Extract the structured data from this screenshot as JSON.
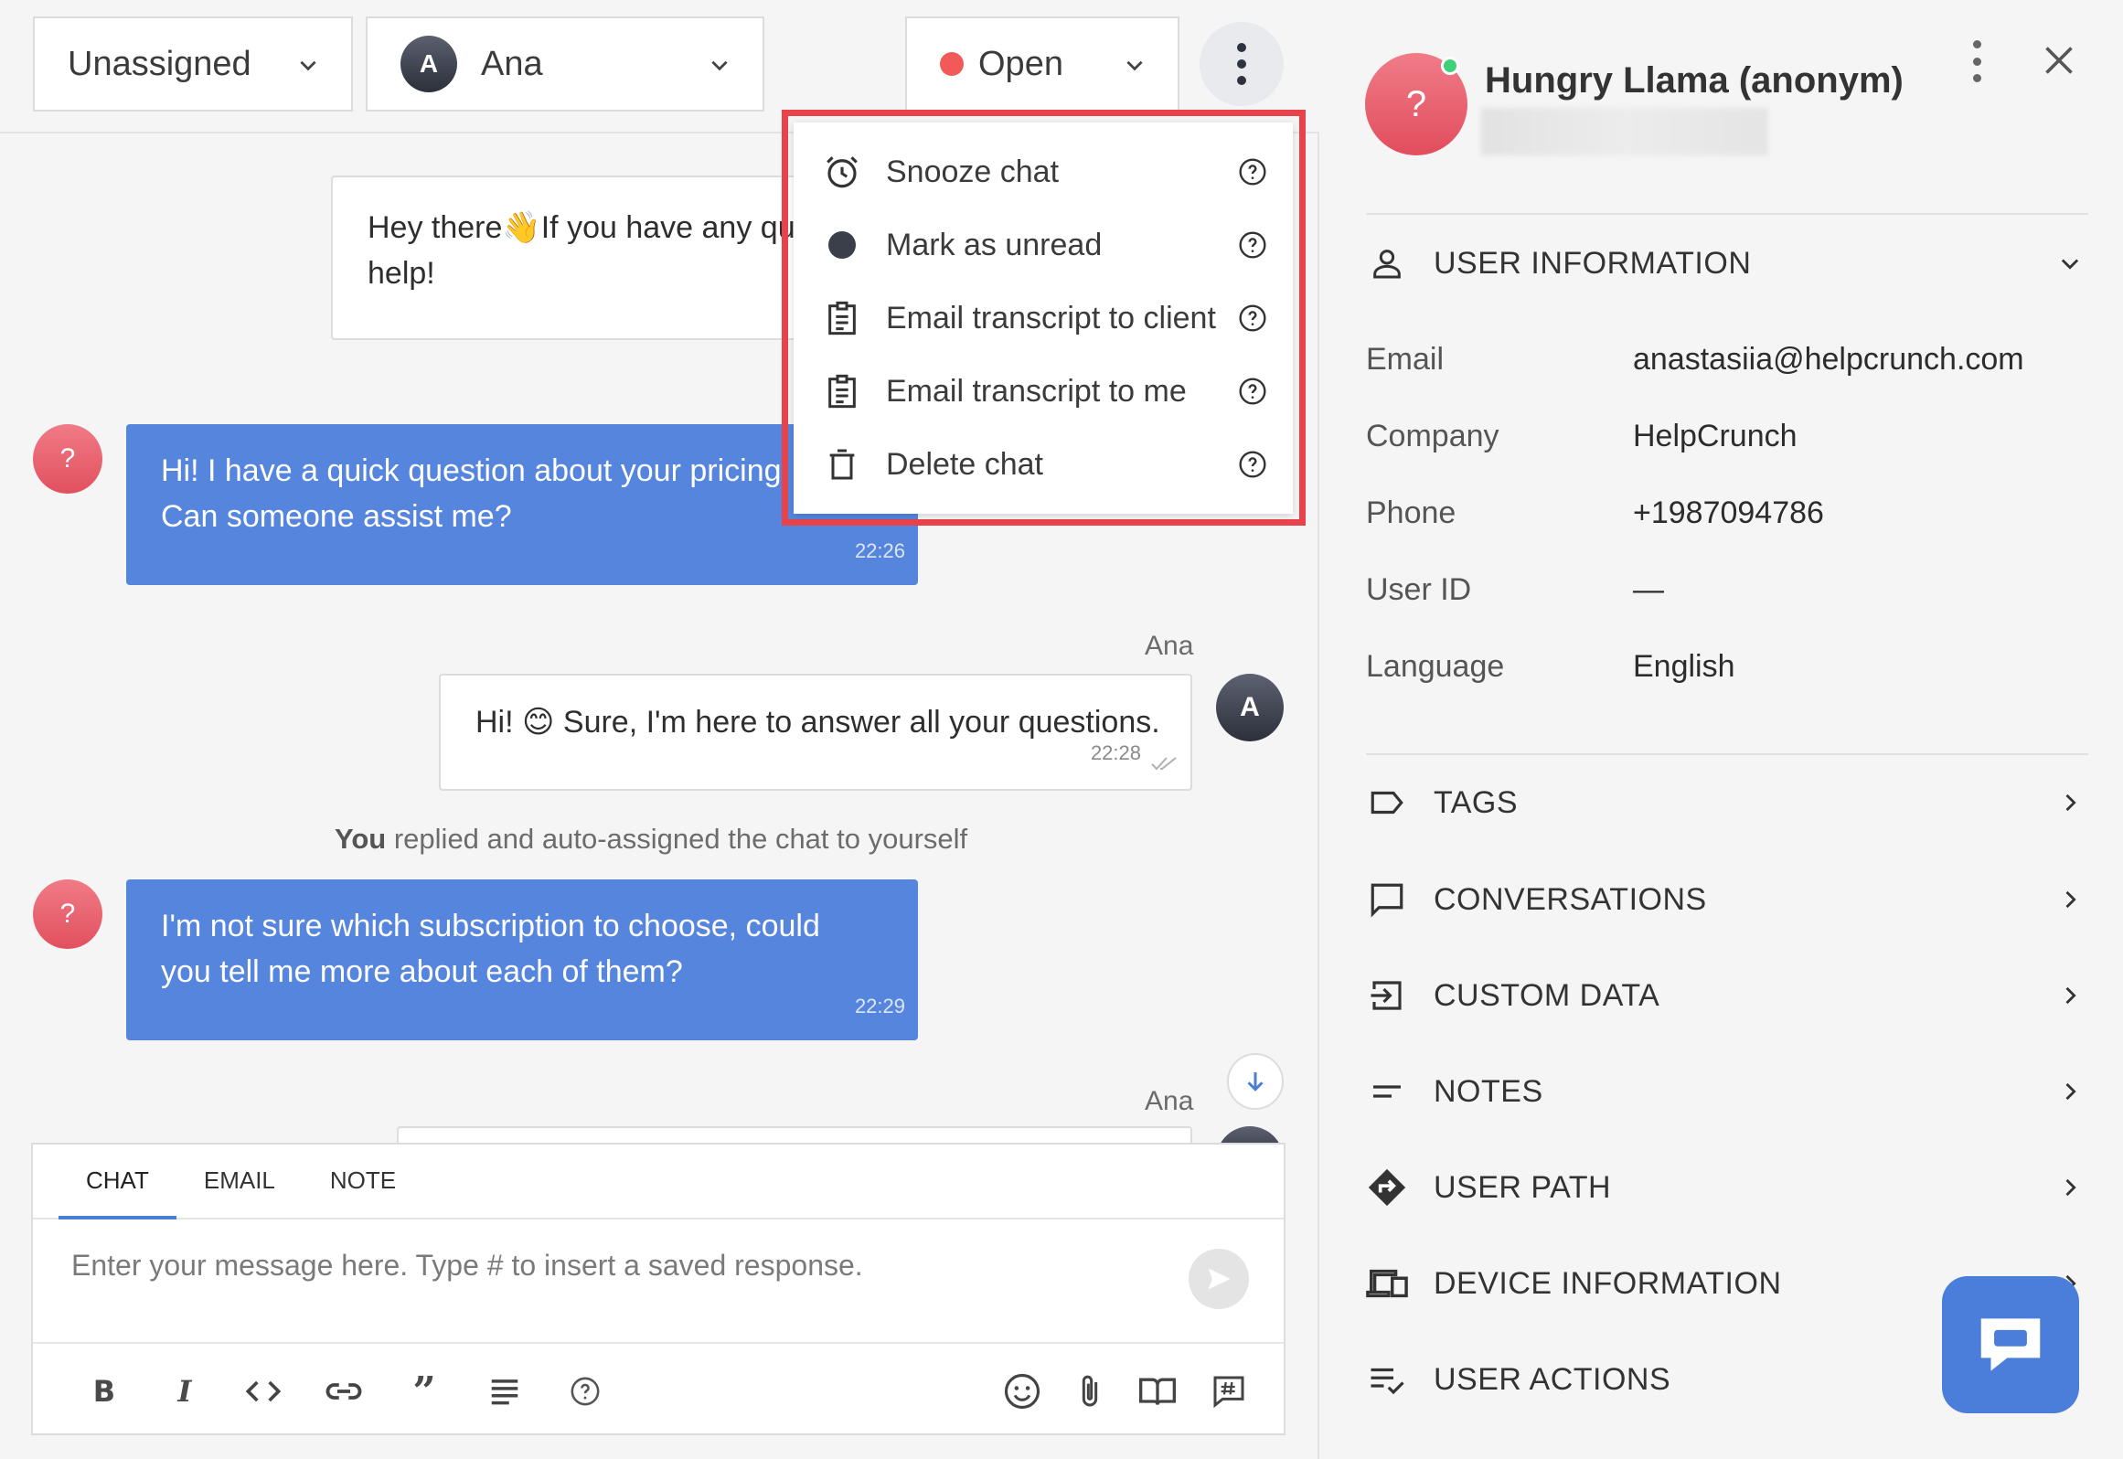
{
  "topbar": {
    "assignee_group": "Unassigned",
    "agent": {
      "initial": "A",
      "name": "Ana"
    },
    "status": "Open"
  },
  "menu": {
    "items": [
      {
        "label": "Snooze chat",
        "icon": "alarm-icon"
      },
      {
        "label": "Mark as unread",
        "icon": "dot-icon"
      },
      {
        "label": "Email transcript to client",
        "icon": "clipboard-icon"
      },
      {
        "label": "Email transcript to me",
        "icon": "clipboard-icon"
      },
      {
        "label": "Delete chat",
        "icon": "trash-icon"
      }
    ]
  },
  "messages": {
    "welcome": {
      "line1": "Hey there👋If you have any qu",
      "line2": "help!"
    },
    "m1": {
      "avatar": "?",
      "line1": "Hi! I have a quick question about your pricing",
      "line2": "Can someone assist me?",
      "time": "22:26"
    },
    "m2": {
      "sender": "Ana",
      "avatar": "A",
      "text": "Hi! 😊 Sure, I'm here to answer all your questions.",
      "time": "22:28"
    },
    "system": {
      "bold": "You",
      "rest": " replied and auto-assigned the chat to yourself"
    },
    "m3": {
      "avatar": "?",
      "line1": "I'm not sure which subscription to choose, could",
      "line2": "you tell me more about each of them?",
      "time": "22:29"
    },
    "m4": {
      "sender": "Ana"
    }
  },
  "composer": {
    "tabs": [
      "CHAT",
      "EMAIL",
      "NOTE"
    ],
    "placeholder": "Enter your message here. Type # to insert a saved response."
  },
  "user": {
    "avatar": "?",
    "name": "Hungry Llama (anonym)"
  },
  "user_info": {
    "title": "USER INFORMATION",
    "rows": [
      {
        "key": "Email",
        "value": "anastasiia@helpcrunch.com"
      },
      {
        "key": "Company",
        "value": "HelpCrunch"
      },
      {
        "key": "Phone",
        "value": "+1987094786"
      },
      {
        "key": "User ID",
        "value": "—"
      },
      {
        "key": "Language",
        "value": "English"
      }
    ]
  },
  "sections": [
    {
      "label": "TAGS",
      "icon": "tag-icon"
    },
    {
      "label": "CONVERSATIONS",
      "icon": "chat-bubble-icon"
    },
    {
      "label": "CUSTOM DATA",
      "icon": "login-icon"
    },
    {
      "label": "NOTES",
      "icon": "notes-icon"
    },
    {
      "label": "USER PATH",
      "icon": "directions-icon"
    },
    {
      "label": "DEVICE INFORMATION",
      "icon": "devices-icon"
    },
    {
      "label": "USER ACTIONS",
      "icon": "checklist-icon"
    }
  ],
  "colors": {
    "accent": "#5585dd",
    "highlight": "#e8434b",
    "status_open": "#f25a5a"
  }
}
